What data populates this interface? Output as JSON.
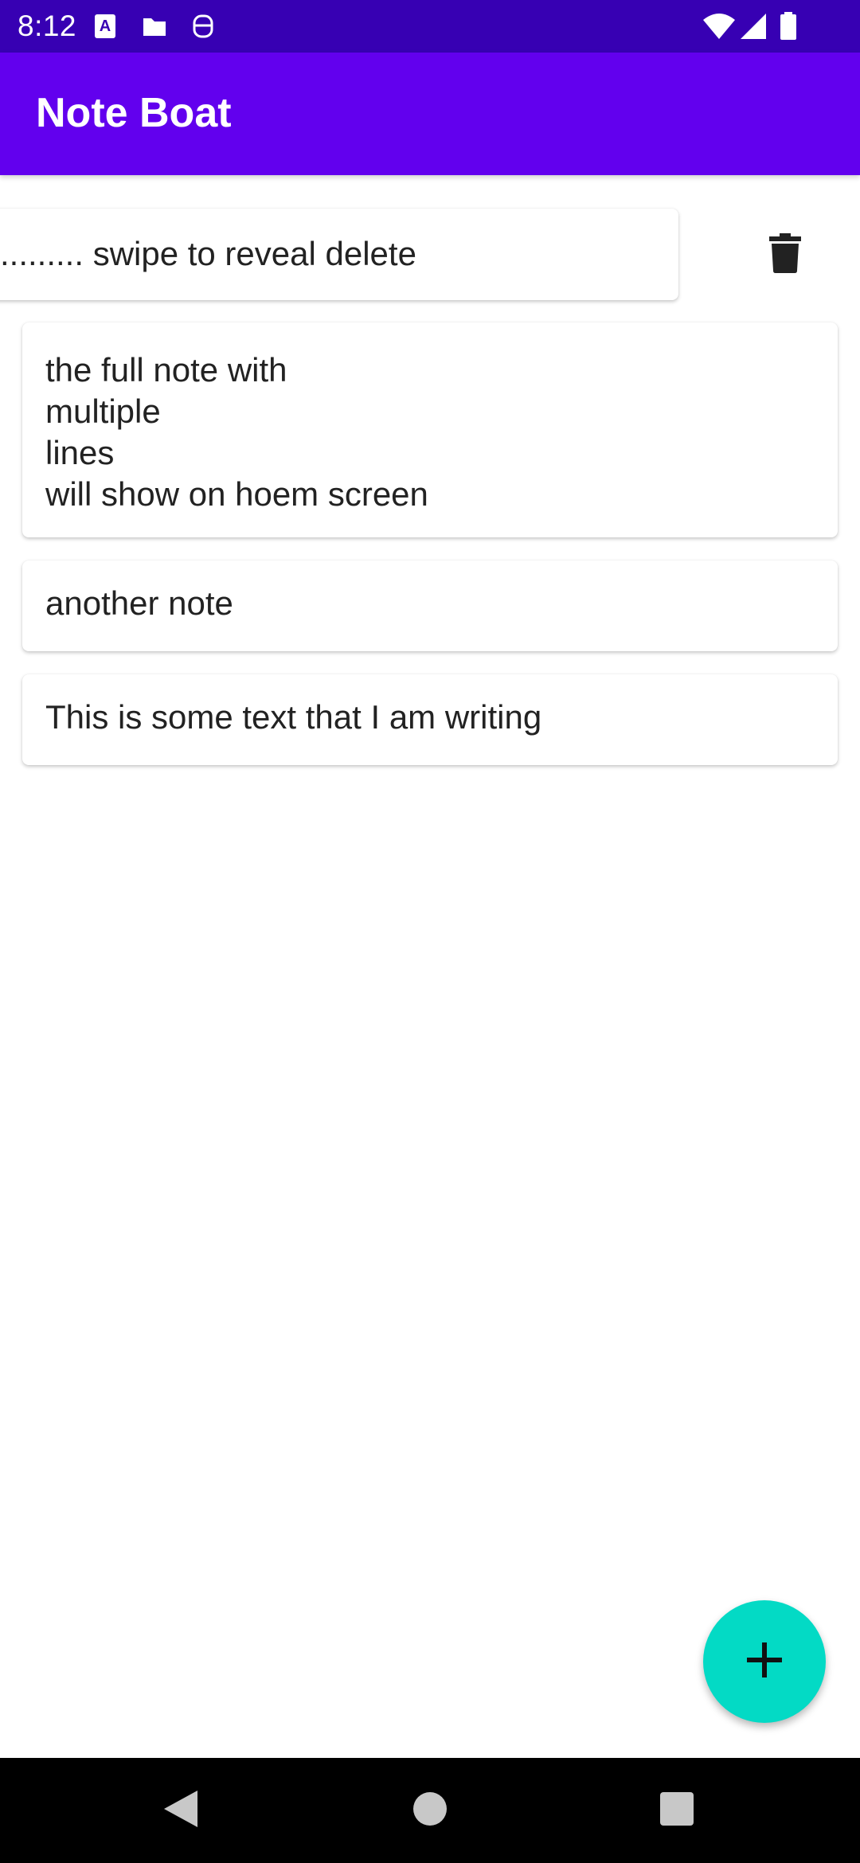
{
  "status_bar": {
    "time": "8:12",
    "icons_left": [
      "accessibility-a-icon",
      "sd-card-icon",
      "face-icon"
    ],
    "icons_right": [
      "wifi-icon",
      "signal-icon",
      "battery-icon"
    ],
    "color": "#3700b3"
  },
  "app_bar": {
    "title": "Note Boat",
    "color": "#6200ee"
  },
  "notes": [
    {
      "text": "......... swipe to reveal delete",
      "state": "swiped"
    },
    {
      "text": "the full note with\nmultiple\nlines\nwill show on hoem screen"
    },
    {
      "text": "another note"
    },
    {
      "text": "This is some text that I am writing"
    }
  ],
  "delete_action": {
    "icon": "trash-icon"
  },
  "fab": {
    "icon": "plus-icon",
    "color": "#03dac5"
  },
  "nav_bar": {
    "buttons": [
      "back-icon",
      "home-icon",
      "recents-icon"
    ]
  }
}
